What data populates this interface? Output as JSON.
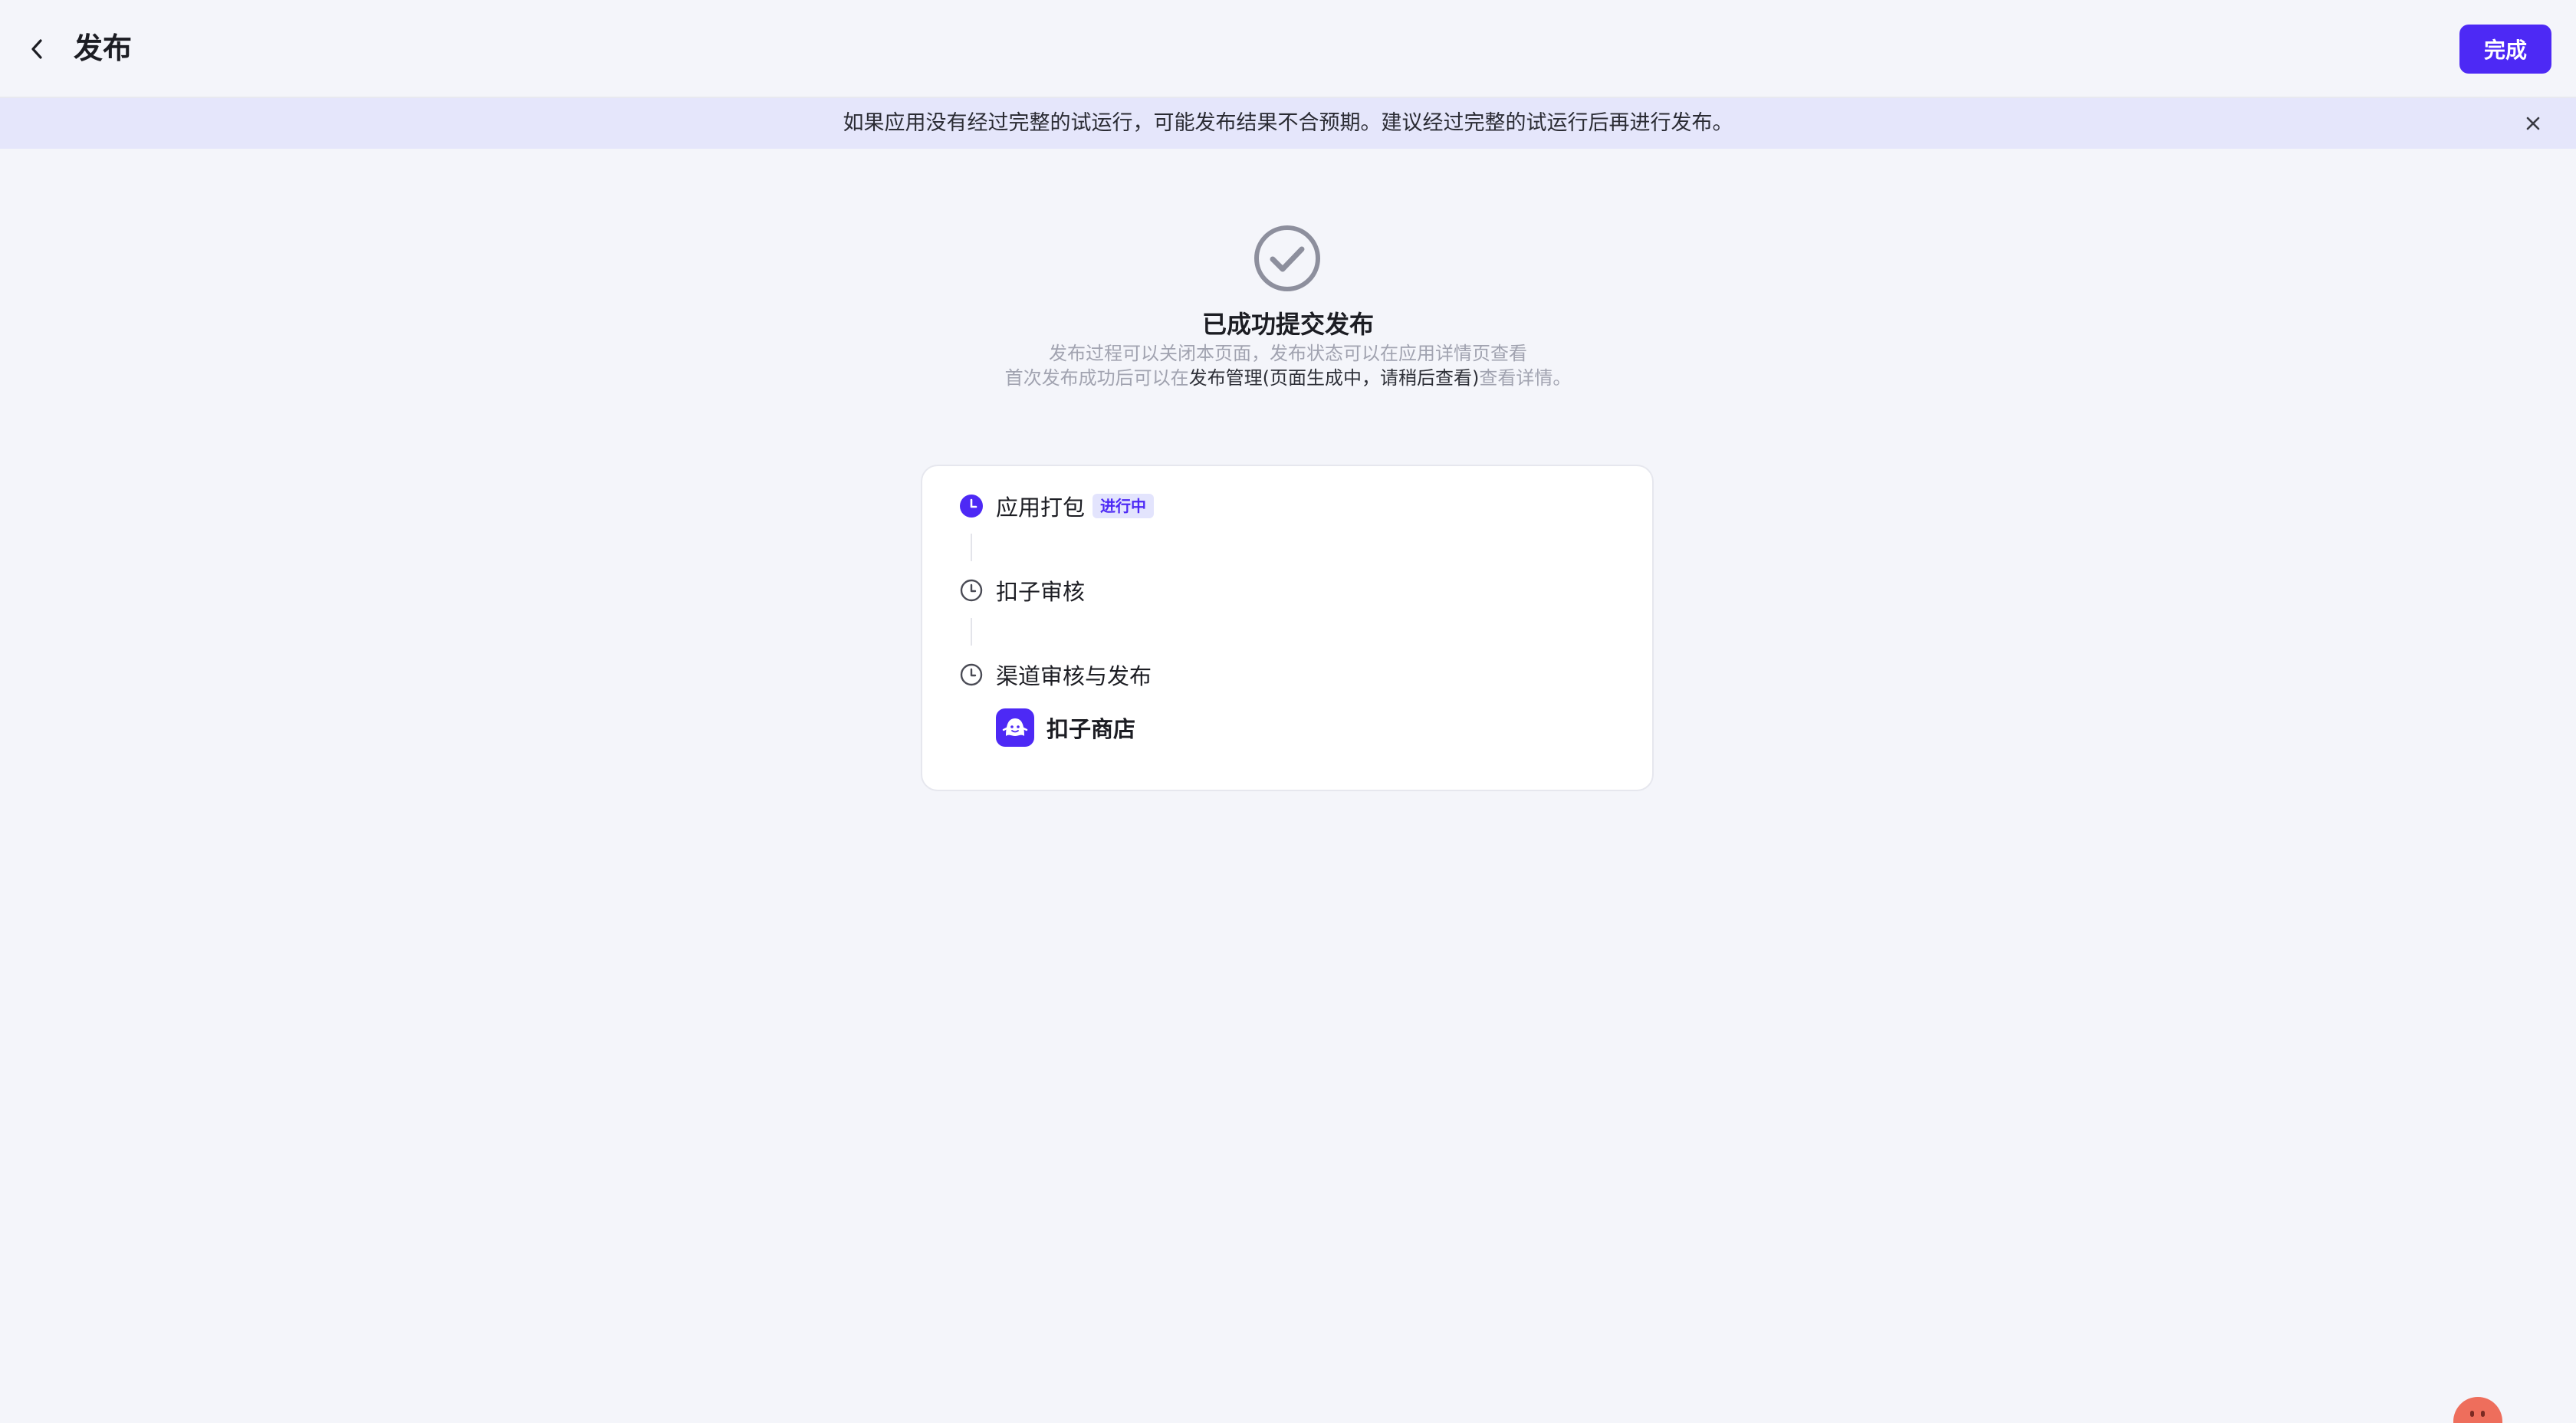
{
  "header": {
    "title": "发布",
    "done_label": "完成"
  },
  "banner": {
    "text": "如果应用没有经过完整的试运行，可能发布结果不合预期。建议经过完整的试运行后再进行发布。"
  },
  "result": {
    "title": "已成功提交发布",
    "line1": "发布过程可以关闭本页面，发布状态可以在应用详情页查看",
    "line2_prefix": "首次发布成功后可以在",
    "line2_highlight": "发布管理(页面生成中，请稍后查看)",
    "line2_link": "查看详情。"
  },
  "steps": [
    {
      "label": "应用打包",
      "status": "进行中",
      "state": "active"
    },
    {
      "label": "扣子审核",
      "state": "pending"
    },
    {
      "label": "渠道审核与发布",
      "state": "pending"
    }
  ],
  "channel": {
    "name": "扣子商店",
    "icon": "coze-store-logo-icon"
  },
  "colors": {
    "accent": "#4d29f5",
    "background": "#f4f5fa",
    "banner": "#e5e6fb",
    "muted_text": "#a1a3b0"
  }
}
